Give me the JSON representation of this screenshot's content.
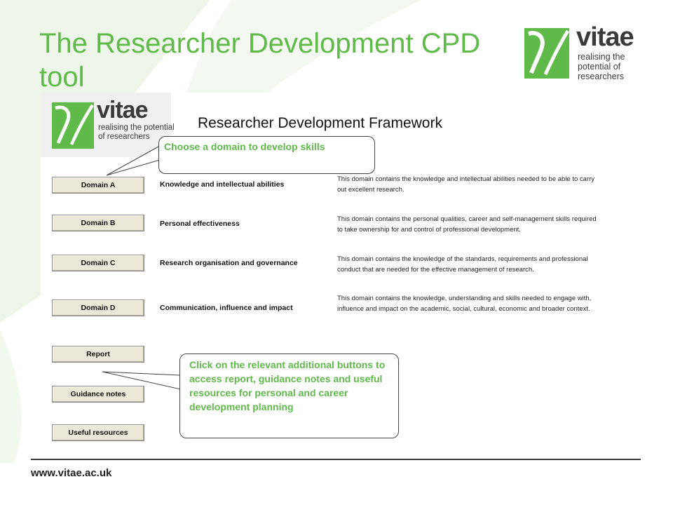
{
  "slide": {
    "title": "The Researcher Development CPD tool",
    "footer_url": "www.vitae.ac.uk"
  },
  "brand": {
    "name": "vitae",
    "tagline": "realising the potential of researchers",
    "colors": {
      "green": "#5fba4a",
      "dark": "#3a3a3a"
    }
  },
  "tool": {
    "title": "Researcher Development Framework",
    "domains": [
      {
        "button": "Domain A",
        "name": "Knowledge and intellectual abilities",
        "description": "This domain contains the knowledge and intellectual abilities needed to be able to carry out excellent research."
      },
      {
        "button": "Domain B",
        "name": "Personal effectiveness",
        "description": "This domain contains the personal qualities, career and self-management skills required to take ownership for and control of professional development."
      },
      {
        "button": "Domain C",
        "name": "Research organisation and governance",
        "description": "This domain contains the knowledge of the standards, requirements and professional conduct that are needed for the effective management of research."
      },
      {
        "button": "Domain D",
        "name": "Communication, influence and impact",
        "description": "This domain contains the knowledge, understanding and skills needed to engage with, influence and impact on the academic, social, cultural, economic and broader context."
      }
    ],
    "extra_buttons": [
      "Report",
      "Guidance notes",
      "Useful resources"
    ]
  },
  "callouts": {
    "domain": "Choose a domain  to develop skills",
    "extras": "Click on the relevant additional buttons to access report, guidance notes and useful resources for personal and career development planning"
  }
}
